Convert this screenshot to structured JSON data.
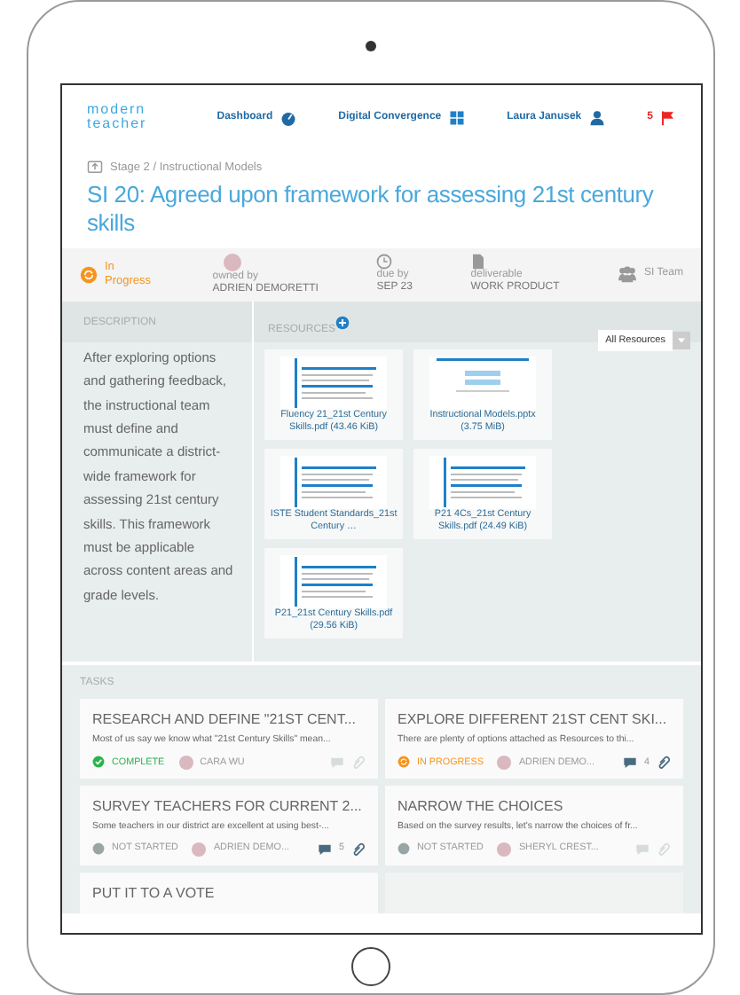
{
  "header": {
    "logo": [
      "modern",
      "teacher"
    ],
    "nav": [
      {
        "kind": "dashboard",
        "label": "Dashboard"
      },
      {
        "kind": "grid",
        "label": "Digital Convergence"
      },
      {
        "kind": "user",
        "label": "Laura Janusek"
      }
    ],
    "flag_count": "5"
  },
  "breadcrumb": "Stage 2 / Instructional Models",
  "title": "SI 20: Agreed upon framework for assessing 21st century skills",
  "meta": [
    {
      "kind": "status",
      "value": "In Progress"
    },
    {
      "kind": "owner",
      "caption": "owned by",
      "value": "ADRIEN DEMORETTI"
    },
    {
      "kind": "due",
      "caption": "due by",
      "value": "SEP 23"
    },
    {
      "kind": "deliverable",
      "caption": "deliverable",
      "value": "WORK PRODUCT"
    },
    {
      "kind": "team",
      "value": "SI Team"
    }
  ],
  "description": {
    "heading": "DESCRIPTION",
    "text": "After exploring options and gathering feedback, the instructional team must define and communicate a district-wide framework for assessing 21st century skills. This framework must be applicable across content areas and grade levels."
  },
  "resources": {
    "heading": "RESOURCES",
    "filter": "All Resources",
    "files": [
      {
        "kind": "doc",
        "name": "Fluency 21_21st Century Skills.pdf (43.46 KiB)"
      },
      {
        "kind": "slide",
        "name": "Instructional Models.pptx (3.75 MiB)"
      },
      {
        "kind": "doc",
        "name": "ISTE Student Standards_21st Century …"
      },
      {
        "kind": "doc",
        "name": "P21 4Cs_21st Century Skills.pdf (24.49 KiB)"
      },
      {
        "kind": "doc",
        "name": "P21_21st Century Skills.pdf (29.56 KiB)"
      }
    ]
  },
  "tasks": {
    "heading": "TASKS",
    "items": [
      {
        "title": "RESEARCH AND DEFINE \"21ST CENT...",
        "excerpt": "Most of us say we know what \"21st Century Skills\" mean...",
        "status": {
          "kind": "complete",
          "label": "COMPLETE"
        },
        "assignee": "CARA WU",
        "activity": false
      },
      {
        "title": "EXPLORE DIFFERENT 21ST CENT SKI...",
        "excerpt": "There are plenty of options attached as Resources to thi...",
        "status": {
          "kind": "in_progress",
          "label": "IN PROGRESS"
        },
        "assignee": "ADRIEN DEMO...",
        "activity": true,
        "comment_count": "4"
      },
      {
        "title": "SURVEY TEACHERS FOR CURRENT 2...",
        "excerpt": "Some teachers in our district are excellent at using best-...",
        "status": {
          "kind": "not_started",
          "label": "NOT STARTED"
        },
        "assignee": "ADRIEN DEMO...",
        "activity": true,
        "comment_count": "5"
      },
      {
        "title": "NARROW THE CHOICES",
        "excerpt": "Based on the survey results, let's narrow the choices of fr...",
        "status": {
          "kind": "not_started",
          "label": "NOT STARTED"
        },
        "assignee": "SHERYL CREST...",
        "activity": false
      },
      {
        "title": "PUT IT TO A VOTE"
      }
    ]
  }
}
